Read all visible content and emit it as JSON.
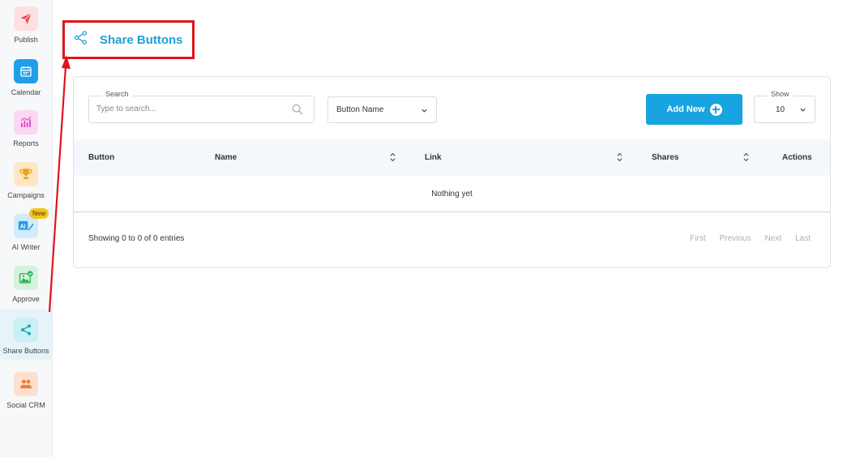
{
  "sidebar": {
    "items": [
      {
        "label": "Publish",
        "icon": "send-icon",
        "bg": "#fde0e0",
        "fg": "#f0454b",
        "active": false
      },
      {
        "label": "Calendar",
        "icon": "calendar-icon",
        "bg": "#1e9fe8",
        "fg": "#ffffff",
        "active": false
      },
      {
        "label": "Reports",
        "icon": "chart-icon",
        "bg": "#fcd6f3",
        "fg": "#d84fc0",
        "active": false
      },
      {
        "label": "Campaigns",
        "icon": "trophy-icon",
        "bg": "#fde7c4",
        "fg": "#f0a21a",
        "active": false
      },
      {
        "label": "AI Writer",
        "icon": "ai-pen-icon",
        "bg": "#d3ebfb",
        "fg": "#1e9fe8",
        "active": false,
        "badge": "New"
      },
      {
        "label": "Approve",
        "icon": "image-check-icon",
        "bg": "#d4f3dc",
        "fg": "#2fb456",
        "active": false
      },
      {
        "label": "Share Buttons",
        "icon": "share-icon",
        "bg": "#c9f0f3",
        "fg": "#19a9b8",
        "active": true
      },
      {
        "label": "Social CRM",
        "icon": "users-icon",
        "bg": "#fde0cf",
        "fg": "#f27a35",
        "active": false
      }
    ]
  },
  "header": {
    "title": "Share Buttons",
    "icon": "share-icon",
    "highlight_color": "#e0141b"
  },
  "toolbar": {
    "search_label": "Search",
    "search_placeholder": "Type to search...",
    "search_value": "",
    "filter_selected": "Button Name",
    "add_label": "Add New",
    "show_label": "Show",
    "show_value": "10"
  },
  "table": {
    "columns": [
      "Button",
      "Name",
      "Link",
      "Shares",
      "Actions"
    ],
    "empty_text": "Nothing yet"
  },
  "footer": {
    "info": "Showing 0 to 0 of 0 entries",
    "pager": [
      "First",
      "Previous",
      "Next",
      "Last"
    ]
  },
  "colors": {
    "accent": "#18a4e0",
    "annotation": "#e0141b"
  }
}
